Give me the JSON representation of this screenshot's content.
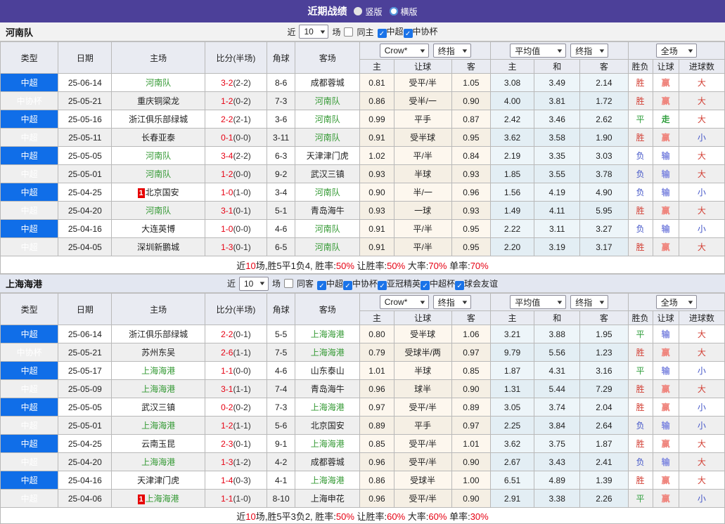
{
  "colors": {
    "accent_purple": "#4c4099",
    "league_super_blue": "#106ee8",
    "league_cup_blue": "#74a3ee",
    "win_red": "#d23d32",
    "lose_blue": "#4355c8",
    "draw_green": "#2f9e3c",
    "score_red": "#e60012",
    "team_green": "#339933",
    "checkbox_blue": "#1a73e8"
  },
  "header": {
    "title": "近期战绩",
    "radio_options": [
      {
        "label": "竖版",
        "selected": true
      },
      {
        "label": "横版",
        "selected": false
      }
    ]
  },
  "table_headers": {
    "cols": [
      "类型",
      "日期",
      "主场",
      "比分(半场)",
      "角球",
      "客场"
    ],
    "dropdowns": {
      "crow": "Crow*",
      "zhi1": "终指",
      "avg": "平均值",
      "zhi2": "终指",
      "full": "全场"
    },
    "subs": [
      "主",
      "让球",
      "客",
      "主",
      "和",
      "客",
      "胜负",
      "让球",
      "进球数"
    ]
  },
  "sections": [
    {
      "team": "河南队",
      "filter": {
        "prefix": "近",
        "count": "10",
        "suffix": "场",
        "same_side": "同主",
        "same_checked": false,
        "leagues": [
          "中超",
          "中协杯"
        ]
      },
      "rows": [
        {
          "lg": "中超",
          "cup": false,
          "date": "25-06-14",
          "home": "河南队",
          "homeG": true,
          "homeB": false,
          "score": "3-2",
          "half": "(2-2)",
          "corner": "8-6",
          "away": "成都蓉城",
          "awayG": false,
          "o": [
            "0.81",
            "受平/半",
            "1.05"
          ],
          "avg": [
            "3.08",
            "3.49",
            "2.14"
          ],
          "res": [
            [
              "胜",
              "win"
            ],
            [
              "赢",
              "win"
            ],
            [
              "大",
              "win"
            ]
          ]
        },
        {
          "lg": "中协杯",
          "cup": true,
          "date": "25-05-21",
          "home": "重庆铜梁龙",
          "homeG": false,
          "homeB": false,
          "score": "1-2",
          "half": "(0-2)",
          "corner": "7-3",
          "away": "河南队",
          "awayG": true,
          "o": [
            "0.86",
            "受半/一",
            "0.90"
          ],
          "avg": [
            "4.00",
            "3.81",
            "1.72"
          ],
          "res": [
            [
              "胜",
              "win"
            ],
            [
              "赢",
              "win"
            ],
            [
              "大",
              "win"
            ]
          ]
        },
        {
          "lg": "中超",
          "cup": false,
          "date": "25-05-16",
          "home": "浙江俱乐部绿城",
          "homeG": false,
          "homeB": false,
          "score": "2-2",
          "half": "(2-1)",
          "corner": "3-6",
          "away": "河南队",
          "awayG": true,
          "o": [
            "0.99",
            "平手",
            "0.87"
          ],
          "avg": [
            "2.42",
            "3.46",
            "2.62"
          ],
          "res": [
            [
              "平",
              "draw"
            ],
            [
              "走",
              "draw"
            ],
            [
              "大",
              "win"
            ]
          ]
        },
        {
          "lg": "中超",
          "cup": false,
          "date": "25-05-11",
          "home": "长春亚泰",
          "homeG": false,
          "homeB": false,
          "score": "0-1",
          "half": "(0-0)",
          "corner": "3-11",
          "away": "河南队",
          "awayG": true,
          "o": [
            "0.91",
            "受半球",
            "0.95"
          ],
          "avg": [
            "3.62",
            "3.58",
            "1.90"
          ],
          "res": [
            [
              "胜",
              "win"
            ],
            [
              "赢",
              "win"
            ],
            [
              "小",
              "lose"
            ]
          ]
        },
        {
          "lg": "中超",
          "cup": false,
          "date": "25-05-05",
          "home": "河南队",
          "homeG": true,
          "homeB": false,
          "score": "3-4",
          "half": "(2-2)",
          "corner": "6-3",
          "away": "天津津门虎",
          "awayG": false,
          "o": [
            "1.02",
            "平/半",
            "0.84"
          ],
          "avg": [
            "2.19",
            "3.35",
            "3.03"
          ],
          "res": [
            [
              "负",
              "lose"
            ],
            [
              "输",
              "lose"
            ],
            [
              "大",
              "win"
            ]
          ]
        },
        {
          "lg": "中超",
          "cup": false,
          "date": "25-05-01",
          "home": "河南队",
          "homeG": true,
          "homeB": false,
          "score": "1-2",
          "half": "(0-0)",
          "corner": "9-2",
          "away": "武汉三镇",
          "awayG": false,
          "o": [
            "0.93",
            "半球",
            "0.93"
          ],
          "avg": [
            "1.85",
            "3.55",
            "3.78"
          ],
          "res": [
            [
              "负",
              "lose"
            ],
            [
              "输",
              "lose"
            ],
            [
              "大",
              "win"
            ]
          ]
        },
        {
          "lg": "中超",
          "cup": false,
          "date": "25-04-25",
          "home": "北京国安",
          "homeG": false,
          "homeB": true,
          "score": "1-0",
          "half": "(1-0)",
          "corner": "3-4",
          "away": "河南队",
          "awayG": true,
          "o": [
            "0.90",
            "半/一",
            "0.96"
          ],
          "avg": [
            "1.56",
            "4.19",
            "4.90"
          ],
          "res": [
            [
              "负",
              "lose"
            ],
            [
              "输",
              "lose"
            ],
            [
              "小",
              "lose"
            ]
          ]
        },
        {
          "lg": "中超",
          "cup": false,
          "date": "25-04-20",
          "home": "河南队",
          "homeG": true,
          "homeB": false,
          "score": "3-1",
          "half": "(0-1)",
          "corner": "5-1",
          "away": "青岛海牛",
          "awayG": false,
          "o": [
            "0.93",
            "一球",
            "0.93"
          ],
          "avg": [
            "1.49",
            "4.11",
            "5.95"
          ],
          "res": [
            [
              "胜",
              "win"
            ],
            [
              "赢",
              "win"
            ],
            [
              "大",
              "win"
            ]
          ]
        },
        {
          "lg": "中超",
          "cup": false,
          "date": "25-04-16",
          "home": "大连英博",
          "homeG": false,
          "homeB": false,
          "score": "1-0",
          "half": "(0-0)",
          "corner": "4-6",
          "away": "河南队",
          "awayG": true,
          "o": [
            "0.91",
            "平/半",
            "0.95"
          ],
          "avg": [
            "2.22",
            "3.11",
            "3.27"
          ],
          "res": [
            [
              "负",
              "lose"
            ],
            [
              "输",
              "lose"
            ],
            [
              "小",
              "lose"
            ]
          ]
        },
        {
          "lg": "中超",
          "cup": false,
          "date": "25-04-05",
          "home": "深圳新鹏城",
          "homeG": false,
          "homeB": false,
          "score": "1-3",
          "half": "(0-1)",
          "corner": "6-5",
          "away": "河南队",
          "awayG": true,
          "o": [
            "0.91",
            "平/半",
            "0.95"
          ],
          "avg": [
            "2.20",
            "3.19",
            "3.17"
          ],
          "res": [
            [
              "胜",
              "win"
            ],
            [
              "赢",
              "win"
            ],
            [
              "大",
              "win"
            ]
          ]
        }
      ],
      "summary": [
        [
          "近",
          false
        ],
        [
          "10",
          true
        ],
        [
          "场,胜5平1负4, 胜率:",
          false
        ],
        [
          "50%",
          true
        ],
        [
          " 让胜率:",
          false
        ],
        [
          "50%",
          true
        ],
        [
          " 大率:",
          false
        ],
        [
          "70%",
          true
        ],
        [
          " 单率:",
          false
        ],
        [
          "70%",
          true
        ]
      ]
    },
    {
      "team": "上海海港",
      "filter": {
        "prefix": "近",
        "count": "10",
        "suffix": "场",
        "same_side": "同客",
        "same_checked": false,
        "leagues": [
          "中超",
          "中协杯",
          "亚冠精英",
          "中超杯",
          "球会友谊"
        ]
      },
      "rows": [
        {
          "lg": "中超",
          "cup": false,
          "date": "25-06-14",
          "home": "浙江俱乐部绿城",
          "homeG": false,
          "homeB": false,
          "score": "2-2",
          "half": "(0-1)",
          "corner": "5-5",
          "away": "上海海港",
          "awayG": true,
          "o": [
            "0.80",
            "受半球",
            "1.06"
          ],
          "avg": [
            "3.21",
            "3.88",
            "1.95"
          ],
          "res": [
            [
              "平",
              "draw"
            ],
            [
              "输",
              "lose"
            ],
            [
              "大",
              "win"
            ]
          ]
        },
        {
          "lg": "中协杯",
          "cup": true,
          "date": "25-05-21",
          "home": "苏州东吴",
          "homeG": false,
          "homeB": false,
          "score": "2-6",
          "half": "(1-1)",
          "corner": "7-5",
          "away": "上海海港",
          "awayG": true,
          "o": [
            "0.79",
            "受球半/两",
            "0.97"
          ],
          "avg": [
            "9.79",
            "5.56",
            "1.23"
          ],
          "res": [
            [
              "胜",
              "win"
            ],
            [
              "赢",
              "win"
            ],
            [
              "大",
              "win"
            ]
          ]
        },
        {
          "lg": "中超",
          "cup": false,
          "date": "25-05-17",
          "home": "上海海港",
          "homeG": true,
          "homeB": false,
          "score": "1-1",
          "half": "(0-0)",
          "corner": "4-6",
          "away": "山东泰山",
          "awayG": false,
          "o": [
            "1.01",
            "半球",
            "0.85"
          ],
          "avg": [
            "1.87",
            "4.31",
            "3.16"
          ],
          "res": [
            [
              "平",
              "draw"
            ],
            [
              "输",
              "lose"
            ],
            [
              "小",
              "lose"
            ]
          ]
        },
        {
          "lg": "中超",
          "cup": false,
          "date": "25-05-09",
          "home": "上海海港",
          "homeG": true,
          "homeB": false,
          "score": "3-1",
          "half": "(1-1)",
          "corner": "7-4",
          "away": "青岛海牛",
          "awayG": false,
          "o": [
            "0.96",
            "球半",
            "0.90"
          ],
          "avg": [
            "1.31",
            "5.44",
            "7.29"
          ],
          "res": [
            [
              "胜",
              "win"
            ],
            [
              "赢",
              "win"
            ],
            [
              "大",
              "win"
            ]
          ]
        },
        {
          "lg": "中超",
          "cup": false,
          "date": "25-05-05",
          "home": "武汉三镇",
          "homeG": false,
          "homeB": false,
          "score": "0-2",
          "half": "(0-2)",
          "corner": "7-3",
          "away": "上海海港",
          "awayG": true,
          "o": [
            "0.97",
            "受平/半",
            "0.89"
          ],
          "avg": [
            "3.05",
            "3.74",
            "2.04"
          ],
          "res": [
            [
              "胜",
              "win"
            ],
            [
              "赢",
              "win"
            ],
            [
              "小",
              "lose"
            ]
          ]
        },
        {
          "lg": "中超",
          "cup": false,
          "date": "25-05-01",
          "home": "上海海港",
          "homeG": true,
          "homeB": false,
          "score": "1-2",
          "half": "(1-1)",
          "corner": "5-6",
          "away": "北京国安",
          "awayG": false,
          "o": [
            "0.89",
            "平手",
            "0.97"
          ],
          "avg": [
            "2.25",
            "3.84",
            "2.64"
          ],
          "res": [
            [
              "负",
              "lose"
            ],
            [
              "输",
              "lose"
            ],
            [
              "小",
              "lose"
            ]
          ]
        },
        {
          "lg": "中超",
          "cup": false,
          "date": "25-04-25",
          "home": "云南玉昆",
          "homeG": false,
          "homeB": false,
          "score": "2-3",
          "half": "(0-1)",
          "corner": "9-1",
          "away": "上海海港",
          "awayG": true,
          "o": [
            "0.85",
            "受平/半",
            "1.01"
          ],
          "avg": [
            "3.62",
            "3.75",
            "1.87"
          ],
          "res": [
            [
              "胜",
              "win"
            ],
            [
              "赢",
              "win"
            ],
            [
              "大",
              "win"
            ]
          ]
        },
        {
          "lg": "中超",
          "cup": false,
          "date": "25-04-20",
          "home": "上海海港",
          "homeG": true,
          "homeB": false,
          "score": "1-3",
          "half": "(1-2)",
          "corner": "4-2",
          "away": "成都蓉城",
          "awayG": false,
          "o": [
            "0.96",
            "受平/半",
            "0.90"
          ],
          "avg": [
            "2.67",
            "3.43",
            "2.41"
          ],
          "res": [
            [
              "负",
              "lose"
            ],
            [
              "输",
              "lose"
            ],
            [
              "大",
              "win"
            ]
          ]
        },
        {
          "lg": "中超",
          "cup": false,
          "date": "25-04-16",
          "home": "天津津门虎",
          "homeG": false,
          "homeB": false,
          "score": "1-4",
          "half": "(0-3)",
          "corner": "4-1",
          "away": "上海海港",
          "awayG": true,
          "o": [
            "0.86",
            "受球半",
            "1.00"
          ],
          "avg": [
            "6.51",
            "4.89",
            "1.39"
          ],
          "res": [
            [
              "胜",
              "win"
            ],
            [
              "赢",
              "win"
            ],
            [
              "大",
              "win"
            ]
          ]
        },
        {
          "lg": "中超",
          "cup": false,
          "date": "25-04-06",
          "home": "上海海港",
          "homeG": true,
          "homeB": true,
          "score": "1-1",
          "half": "(1-0)",
          "corner": "8-10",
          "away": "上海申花",
          "awayG": false,
          "o": [
            "0.96",
            "受平/半",
            "0.90"
          ],
          "avg": [
            "2.91",
            "3.38",
            "2.26"
          ],
          "res": [
            [
              "平",
              "draw"
            ],
            [
              "赢",
              "win"
            ],
            [
              "小",
              "lose"
            ]
          ]
        }
      ],
      "summary": [
        [
          "近",
          false
        ],
        [
          "10",
          true
        ],
        [
          "场,胜5平3负2, 胜率:",
          false
        ],
        [
          "50%",
          true
        ],
        [
          " 让胜率:",
          false
        ],
        [
          "60%",
          true
        ],
        [
          " 大率:",
          false
        ],
        [
          "60%",
          true
        ],
        [
          " 单率:",
          false
        ],
        [
          "30%",
          true
        ]
      ]
    }
  ]
}
